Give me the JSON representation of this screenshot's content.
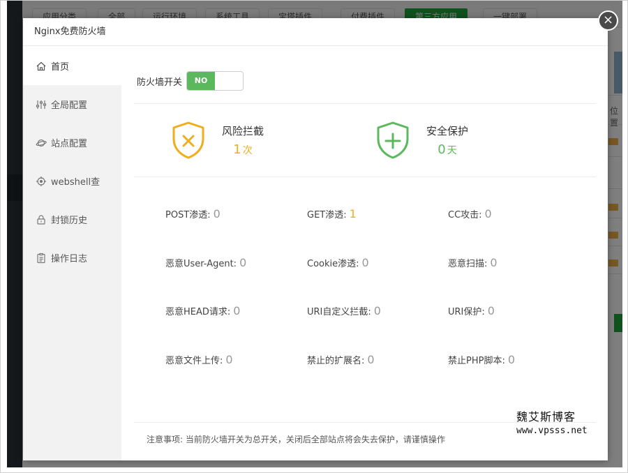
{
  "background": {
    "tabs": [
      "应用分类",
      "全部",
      "运行环境",
      "系统工具",
      "宝塔插件",
      "付费插件",
      "第三方应用",
      "一键部署"
    ],
    "active_tab_index": 6,
    "side_label": "位置"
  },
  "dialog": {
    "title": "Nginx免费防火墙",
    "close_glyph": "×"
  },
  "sidebar": {
    "items": [
      {
        "label": "首页",
        "icon": "home-icon"
      },
      {
        "label": "全局配置",
        "icon": "sliders-icon"
      },
      {
        "label": "站点配置",
        "icon": "planet-icon"
      },
      {
        "label": "webshell查",
        "icon": "target-icon"
      },
      {
        "label": "封锁历史",
        "icon": "lock-icon"
      },
      {
        "label": "操作日志",
        "icon": "clipboard-icon"
      }
    ],
    "active_index": 0
  },
  "firewall": {
    "switch_label": "防火墙开关",
    "switch_state": "NO"
  },
  "summary": {
    "risk": {
      "title": "风险拦截",
      "value": "1",
      "unit": "次",
      "color": "#f0ad1e",
      "icon": "shield-x-icon"
    },
    "safe": {
      "title": "安全保护",
      "value": "0",
      "unit": "天",
      "color": "#5bb85d",
      "icon": "shield-plus-icon"
    }
  },
  "attacks": [
    {
      "label": "POST渗透:",
      "value": "0"
    },
    {
      "label": "GET渗透:",
      "value": "1"
    },
    {
      "label": "CC攻击:",
      "value": "0"
    },
    {
      "label": "恶意User-Agent:",
      "value": "0"
    },
    {
      "label": "Cookie渗透:",
      "value": "0"
    },
    {
      "label": "恶意扫描:",
      "value": "0"
    },
    {
      "label": "恶意HEAD请求:",
      "value": "0"
    },
    {
      "label": "URI自定义拦截:",
      "value": "0"
    },
    {
      "label": "URI保护:",
      "value": "0"
    },
    {
      "label": "恶意文件上传:",
      "value": "0"
    },
    {
      "label": "禁止的扩展名:",
      "value": "0"
    },
    {
      "label": "禁止PHP脚本:",
      "value": "0"
    }
  ],
  "notice": "注意事项: 当前防火墙开关为总开关，关闭后全部站点将会失去保护，请谨慎操作",
  "watermark": {
    "title": "魏艾斯博客",
    "url": "www.vpsss.net"
  }
}
